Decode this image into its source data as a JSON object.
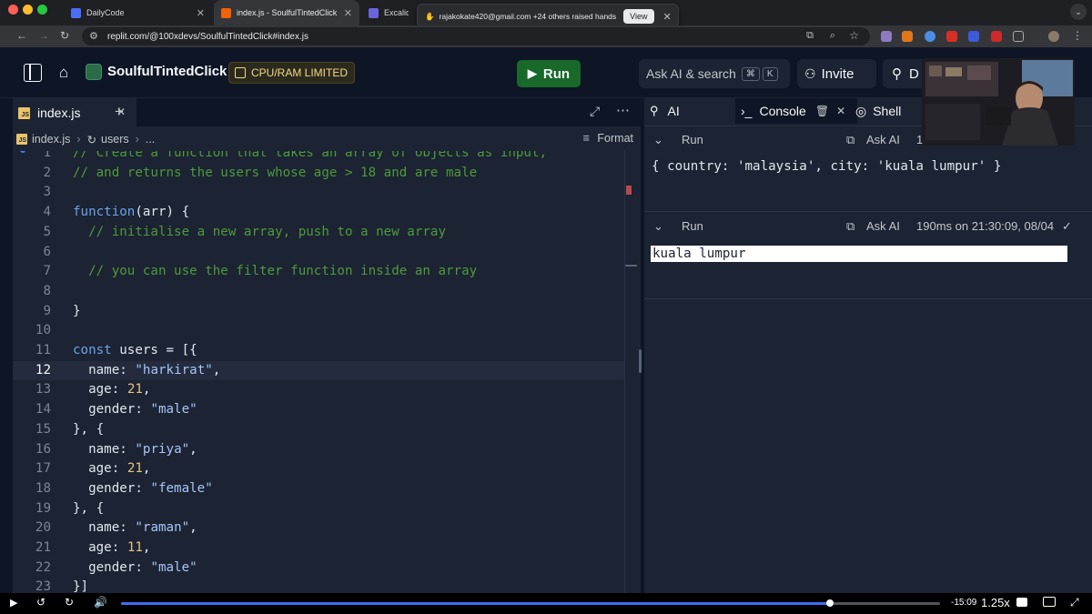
{
  "browser": {
    "tabs": [
      {
        "title": "DailyCode"
      },
      {
        "title": "index.js - SoulfulTintedClick"
      },
      {
        "title": "Excalidraw"
      }
    ],
    "notification": {
      "text": "rajakokate420@gmail.com +24 others raised hands",
      "button": "View"
    },
    "url": "replit.com/@100xdevs/SoulfulTintedClick#index.js"
  },
  "header": {
    "project_name": "SoulfulTintedClick",
    "badge": "CPU/RAM LIMITED",
    "run_label": "Run",
    "search_label": "Ask AI & search",
    "search_kbd_cmd": "⌘",
    "search_kbd_key": "K",
    "invite_label": "Invite",
    "deploy_label": "D"
  },
  "editor": {
    "file_tab": "index.js",
    "breadcrumb_file": "index.js",
    "breadcrumb_symbol": "users",
    "breadcrumb_more": "...",
    "format_label": "Format",
    "current_line": 12,
    "lines": [
      {
        "n": "1",
        "code": "// Create a function that takes an array of objects as input,"
      },
      {
        "n": "2",
        "code": "// and returns the users whose age > 18 and are male"
      },
      {
        "n": "3",
        "code": ""
      },
      {
        "n": "4",
        "code": "function(arr) {"
      },
      {
        "n": "5",
        "code": "  // initialise a new array, push to a new array"
      },
      {
        "n": "6",
        "code": ""
      },
      {
        "n": "7",
        "code": "  // you can use the filter function inside an array"
      },
      {
        "n": "8",
        "code": ""
      },
      {
        "n": "9",
        "code": "}"
      },
      {
        "n": "10",
        "code": ""
      },
      {
        "n": "11",
        "code": "const users = [{"
      },
      {
        "n": "12",
        "code": "  name: \"harkirat\","
      },
      {
        "n": "13",
        "code": "  age: 21,"
      },
      {
        "n": "14",
        "code": "  gender: \"male\""
      },
      {
        "n": "15",
        "code": "}, {"
      },
      {
        "n": "16",
        "code": "  name: \"priya\","
      },
      {
        "n": "17",
        "code": "  age: 21,"
      },
      {
        "n": "18",
        "code": "  gender: \"female\""
      },
      {
        "n": "19",
        "code": "}, {"
      },
      {
        "n": "20",
        "code": "  name: \"raman\","
      },
      {
        "n": "21",
        "code": "  age: 11,"
      },
      {
        "n": "22",
        "code": "  gender: \"male\""
      },
      {
        "n": "23",
        "code": "}]"
      }
    ]
  },
  "console": {
    "tabs": {
      "ai": "AI",
      "console": "Console",
      "shell": "Shell"
    },
    "runs": [
      {
        "label": "Run",
        "ask": "Ask AI",
        "meta": "1",
        "output": "{ country: 'malaysia', city: 'kuala lumpur' }"
      },
      {
        "label": "Run",
        "ask": "Ask AI",
        "meta": "190ms on 21:30:09, 08/04",
        "output": "kuala lumpur"
      }
    ]
  },
  "player": {
    "time_remaining": "-15:09",
    "speed": "1.25x",
    "progress": 0.865
  },
  "colors": {
    "run_button": "#18692a",
    "badge_text": "#f3d889",
    "comment": "#4e9a3a",
    "keyword": "#6ca2e8",
    "string": "#a6c5f7",
    "number": "#e2c47c"
  }
}
